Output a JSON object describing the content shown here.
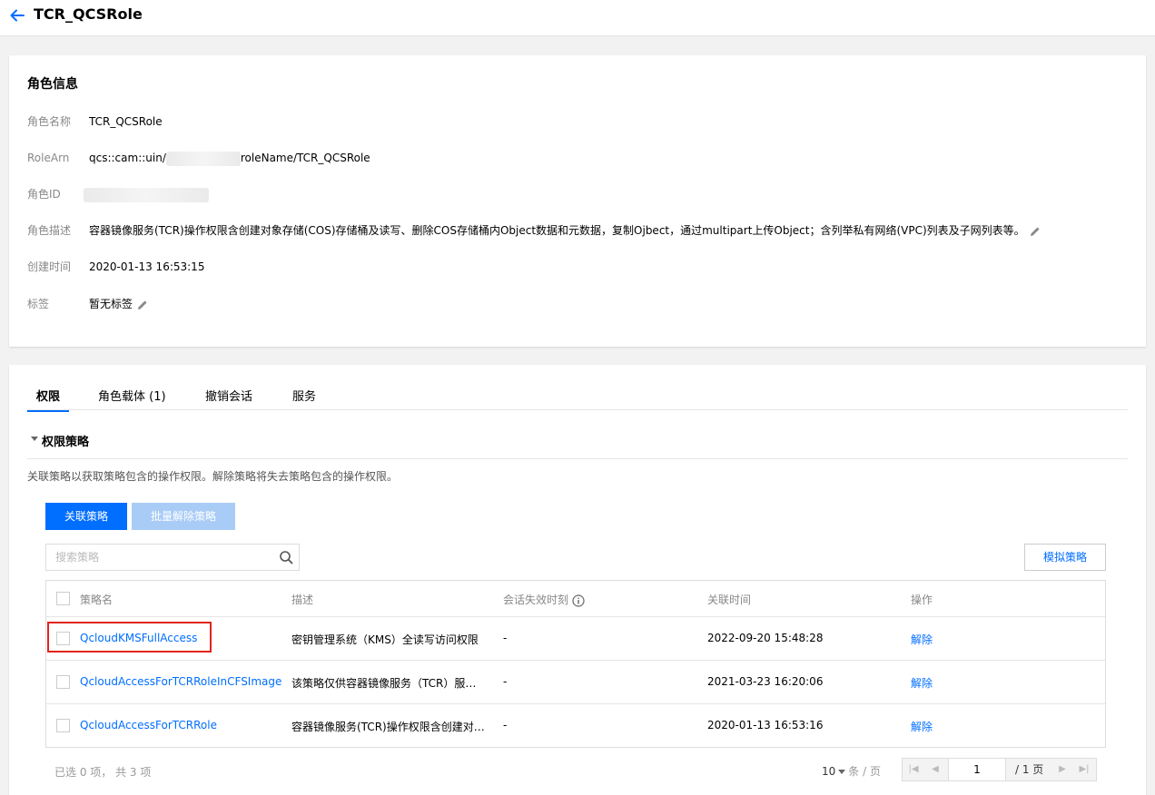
{
  "header": {
    "title": "TCR_QCSRole"
  },
  "role_info": {
    "title": "角色信息",
    "name_label": "角色名称",
    "name_value": "TCR_QCSRole",
    "arn_label": "RoleArn",
    "arn_prefix": "qcs::cam::uin/",
    "arn_suffix": "roleName/TCR_QCSRole",
    "id_label": "角色ID",
    "desc_label": "角色描述",
    "desc_value": "容器镜像服务(TCR)操作权限含创建对象存储(COS)存储桶及读写、删除COS存储桶内Object数据和元数据，复制Ojbect，通过multipart上传Object；含列举私有网络(VPC)列表及子网列表等。",
    "created_label": "创建时间",
    "created_value": "2020-01-13 16:53:15",
    "tags_label": "标签",
    "tags_value": "暂无标签"
  },
  "tabs": [
    {
      "label": "权限"
    },
    {
      "label": "角色载体 (1)"
    },
    {
      "label": "撤销会话"
    },
    {
      "label": "服务"
    }
  ],
  "policies": {
    "section_title": "权限策略",
    "description": "关联策略以获取策略包含的操作权限。解除策略将失去策略包含的操作权限。",
    "attach_button": "关联策略",
    "batch_detach_button": "批量解除策略",
    "search_placeholder": "搜索策略",
    "simulate_button": "模拟策略",
    "columns": [
      "策略名",
      "描述",
      "会话失效时刻",
      "关联时间",
      "操作"
    ],
    "rows": [
      {
        "name": "QcloudKMSFullAccess",
        "desc": "密钥管理系统（KMS）全读写访问权限",
        "expire": "-",
        "time": "2022-09-20 15:48:28",
        "action": "解除"
      },
      {
        "name": "QcloudAccessForTCRRoleInCFSImage",
        "desc": "该策略仅供容器镜像服务（TCR）服…",
        "expire": "-",
        "time": "2021-03-23 16:20:06",
        "action": "解除"
      },
      {
        "name": "QcloudAccessForTCRRole",
        "desc": "容器镜像服务(TCR)操作权限含创建对…",
        "expire": "-",
        "time": "2020-01-13 16:53:16",
        "action": "解除"
      }
    ],
    "selected_info": "已选 0 项， 共 3 项",
    "page_size": "10",
    "per_page": "条 / 页",
    "page_current": "1",
    "page_total": "/ 1 页"
  },
  "colors": {
    "accent": "#006eff",
    "highlight": "#e1251b",
    "disabled": "#a9ccf7"
  }
}
